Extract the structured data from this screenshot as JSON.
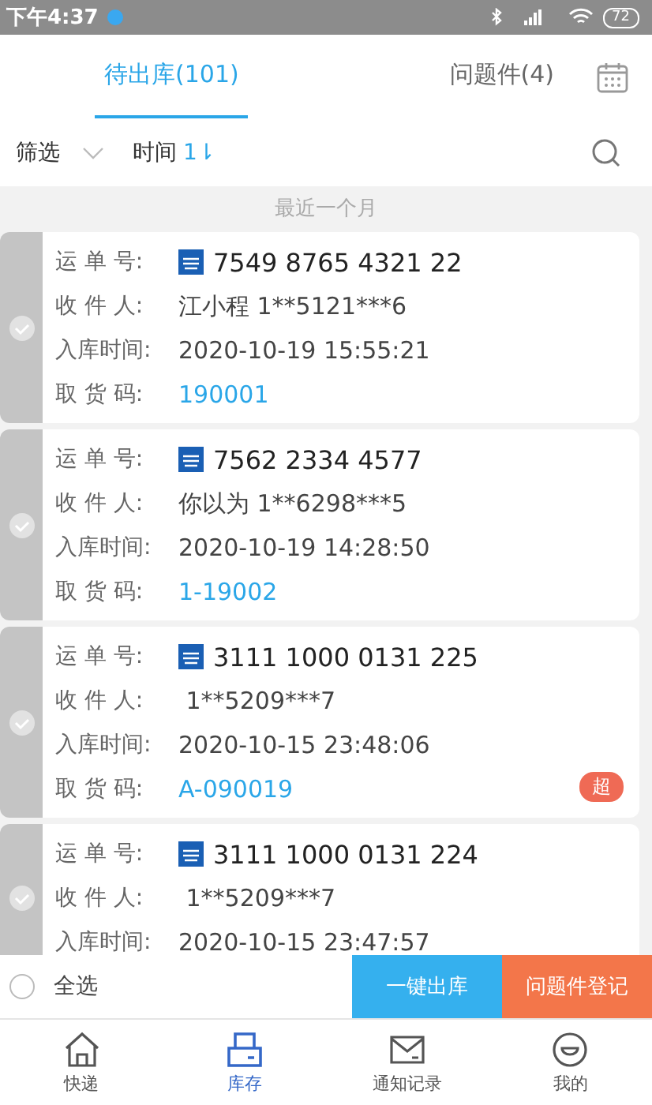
{
  "status_bar": {
    "time": "下午4:37",
    "battery": "72"
  },
  "tabs": [
    {
      "label": "待出库(101)",
      "selected": true
    },
    {
      "label": "问题件(4)",
      "selected": false
    }
  ],
  "filter_bar": {
    "filter": "筛选",
    "sort": "时间",
    "sort_arrow": "1⇂"
  },
  "section_label": "最近一个月",
  "shipments": [
    {
      "selected": false,
      "fields": [
        {
          "label": "运 单 号:",
          "value": "7549 8765 4321 22",
          "kind": "waybill"
        },
        {
          "label": "收 件 人:",
          "value": "江小程 1**5121***6",
          "kind": "text"
        },
        {
          "label": "入库时间:",
          "value": "2020-10-19 15:55:21",
          "kind": "text"
        },
        {
          "label": "取 货 码:",
          "value": "190001",
          "kind": "code"
        }
      ]
    },
    {
      "selected": false,
      "fields": [
        {
          "label": "运 单 号:",
          "value": "7562 2334 4577",
          "kind": "waybill"
        },
        {
          "label": "收 件 人:",
          "value": "你以为 1**6298***5",
          "kind": "text"
        },
        {
          "label": "入库时间:",
          "value": "2020-10-19 14:28:50",
          "kind": "text"
        },
        {
          "label": "取 货 码:",
          "value": "1-19002",
          "kind": "code"
        }
      ]
    },
    {
      "selected": false,
      "badge": "超",
      "fields": [
        {
          "label": "运 单 号:",
          "value": "3111 1000 0131 225",
          "kind": "waybill"
        },
        {
          "label": "收 件 人:",
          "value": " 1**5209***7",
          "kind": "text"
        },
        {
          "label": "入库时间:",
          "value": "2020-10-15 23:48:06",
          "kind": "text"
        },
        {
          "label": "取 货 码:",
          "value": "A-090019",
          "kind": "code"
        }
      ]
    },
    {
      "selected": false,
      "fields": [
        {
          "label": "运 单 号:",
          "value": "3111 1000 0131 224",
          "kind": "waybill"
        },
        {
          "label": "收 件 人:",
          "value": " 1**5209***7",
          "kind": "text"
        },
        {
          "label": "入库时间:",
          "value": "2020-10-15 23:47:57",
          "kind": "text"
        }
      ]
    }
  ],
  "action_bar": {
    "select_all": {
      "label": "全选",
      "checked": false
    },
    "buttons": [
      "一键出库",
      "问题件登记"
    ]
  },
  "bottom_nav": [
    {
      "label": "快递",
      "kind": "home",
      "selected": false
    },
    {
      "label": "库存",
      "kind": "printer",
      "selected": true
    },
    {
      "label": "通知记录",
      "kind": "mail",
      "selected": false
    },
    {
      "label": "我的",
      "kind": "face",
      "selected": false
    }
  ]
}
